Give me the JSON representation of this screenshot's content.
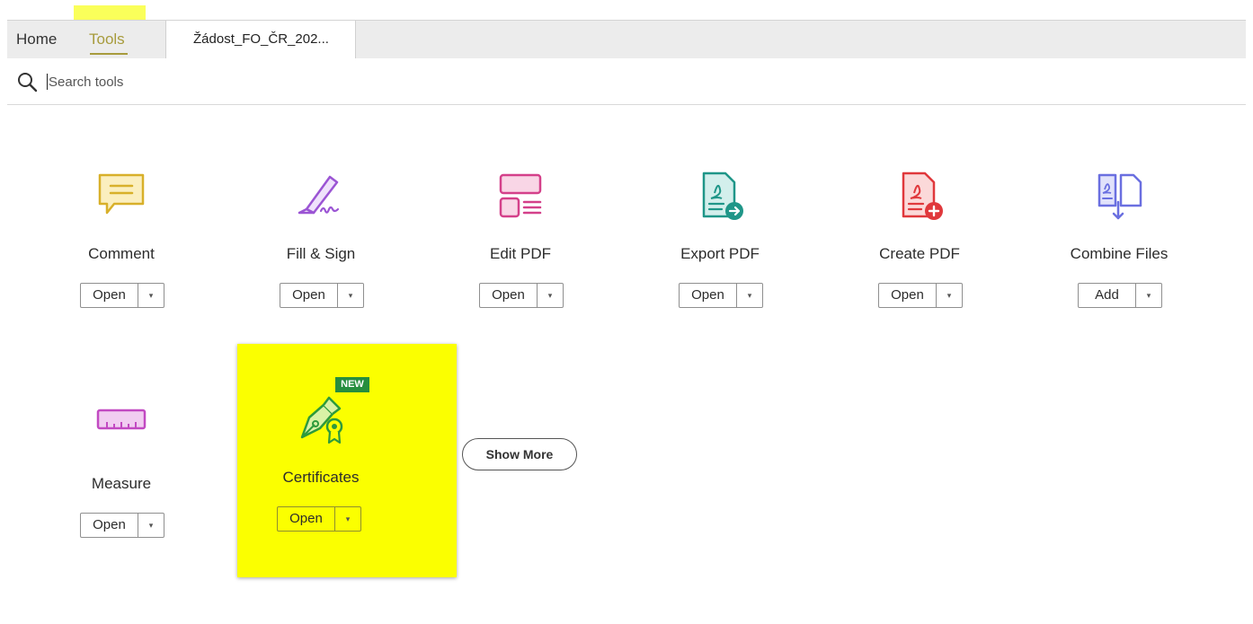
{
  "tabs": {
    "home": "Home",
    "tools": "Tools",
    "document": "Žádost_FO_ČR_202..."
  },
  "search": {
    "placeholder": "Search tools",
    "icon": "search-icon"
  },
  "tools": [
    {
      "label": "Comment",
      "button": "Open",
      "icon": "comment-icon",
      "color": "#d8b02a"
    },
    {
      "label": "Fill & Sign",
      "button": "Open",
      "icon": "fill-sign-icon",
      "color": "#9b55d4"
    },
    {
      "label": "Edit PDF",
      "button": "Open",
      "icon": "edit-pdf-icon",
      "color": "#d4408a"
    },
    {
      "label": "Export PDF",
      "button": "Open",
      "icon": "export-pdf-icon",
      "color": "#1f9688"
    },
    {
      "label": "Create PDF",
      "button": "Open",
      "icon": "create-pdf-icon",
      "color": "#e0383c"
    },
    {
      "label": "Combine Files",
      "button": "Add",
      "icon": "combine-files-icon",
      "color": "#6a6fe0"
    },
    {
      "label": "Measure",
      "button": "Open",
      "icon": "measure-icon",
      "color": "#c24ac2"
    }
  ],
  "certificates": {
    "badge": "NEW",
    "label": "Certificates",
    "button": "Open",
    "icon": "certificates-icon",
    "color": "#2e9a3c",
    "highlight": "#fbff00"
  },
  "show_more": "Show More",
  "dropdown_arrow": "▾"
}
